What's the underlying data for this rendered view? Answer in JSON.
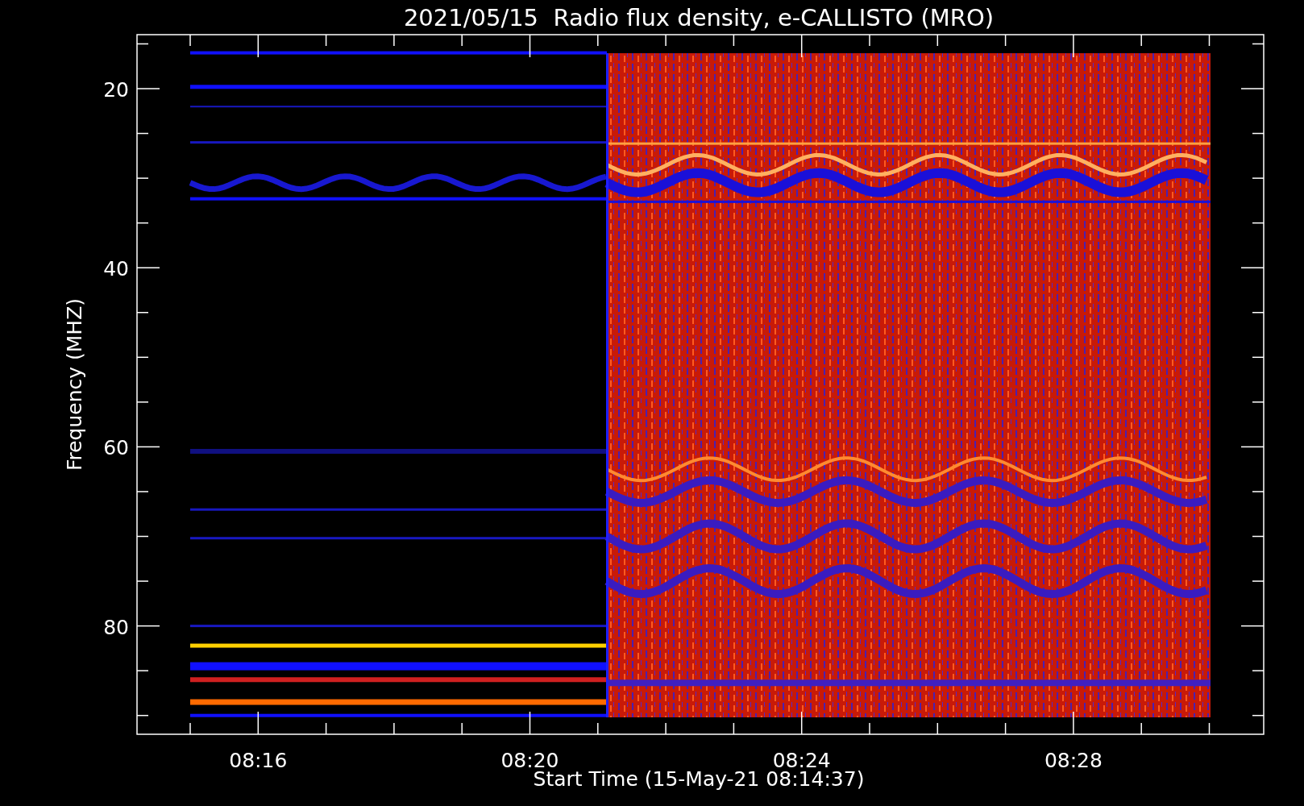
{
  "title": "2021/05/15  Radio flux density, e-CALLISTO (MRO)",
  "y_axis": {
    "label": "Frequency (MHZ)",
    "ticks": [
      "20",
      "40",
      "60",
      "80"
    ]
  },
  "x_axis": {
    "label": "Start Time (15-May-21 08:14:37)",
    "ticks": [
      "08:16",
      "08:20",
      "08:24",
      "08:28"
    ]
  }
}
